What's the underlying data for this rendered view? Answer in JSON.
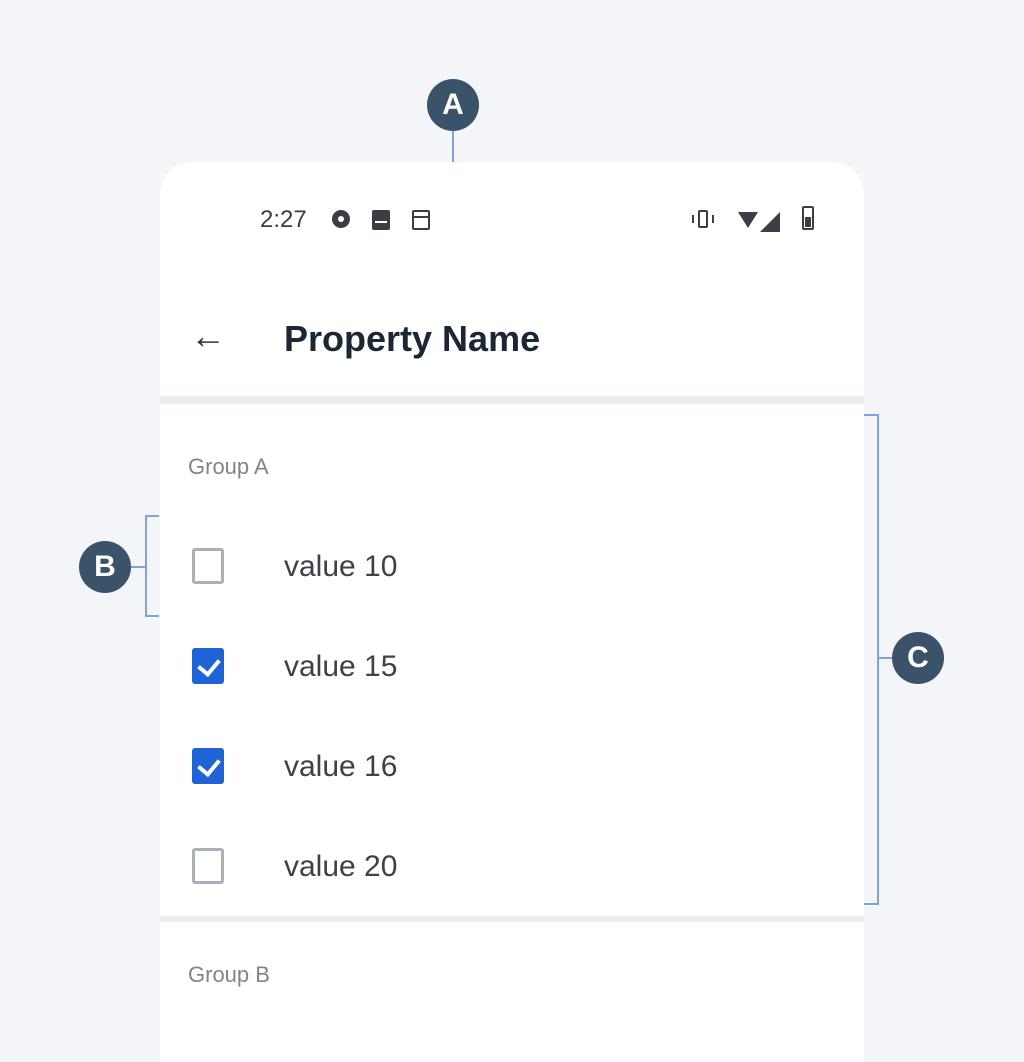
{
  "callouts": {
    "a": "A",
    "b": "B",
    "c": "C"
  },
  "status_bar": {
    "time": "2:27",
    "left_icons": [
      "gear-icon",
      "sim-card-icon",
      "calendar-icon"
    ],
    "right_icons": [
      "vibrate-icon",
      "wifi-icon",
      "signal-icon",
      "battery-icon"
    ]
  },
  "app_bar": {
    "back_icon": "arrow-left-icon",
    "back_glyph": "←",
    "title": "Property Name"
  },
  "groups": [
    {
      "label": "Group A",
      "options": [
        {
          "label": "value 10",
          "checked": false
        },
        {
          "label": "value 15",
          "checked": true
        },
        {
          "label": "value 16",
          "checked": true
        },
        {
          "label": "value 20",
          "checked": false
        }
      ]
    },
    {
      "label": "Group B",
      "options": []
    }
  ],
  "colors": {
    "accent": "#1f63d6",
    "callout": "#3a536b",
    "annotation_line": "#7fa3dc",
    "background": "#f3f5f8"
  }
}
